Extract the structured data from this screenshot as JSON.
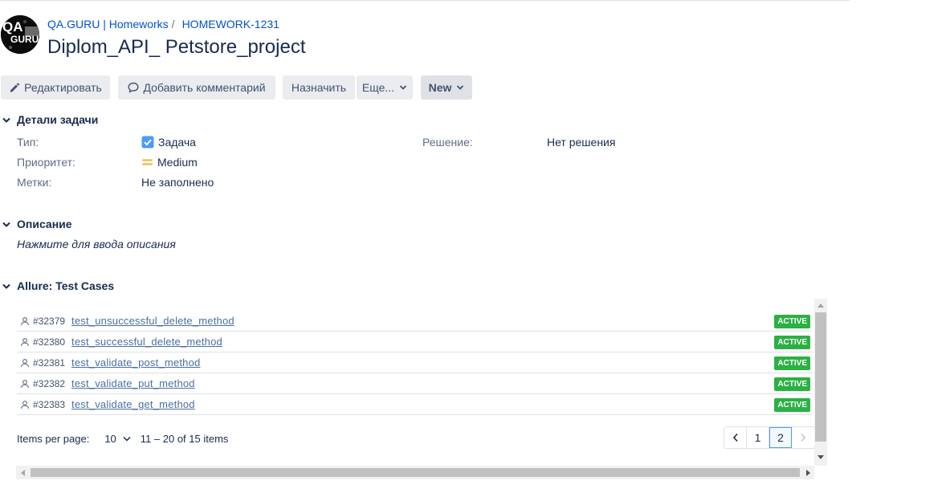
{
  "logo": {
    "text_top": "QA",
    "text_bottom": "GURU"
  },
  "breadcrumbs": [
    {
      "label": "QA.GURU | Homeworks"
    },
    {
      "label": "HOMEWORK-1231"
    }
  ],
  "breadcrumb_separator": "/",
  "issue": {
    "title": "Diplom_API_ Petstore_project"
  },
  "toolbar": {
    "edit_label": "Редактировать",
    "comment_label": "Добавить комментарий",
    "assign_label": "Назначить",
    "more_label": "Еще...",
    "status_label": "New"
  },
  "details": {
    "heading": "Детали задачи",
    "type_label": "Тип:",
    "type_value": "Задача",
    "priority_label": "Приоритет:",
    "priority_value": "Medium",
    "labels_label": "Метки:",
    "labels_value": "Не заполнено",
    "resolution_label": "Решение:",
    "resolution_value": "Нет решения"
  },
  "description": {
    "heading": "Описание",
    "placeholder": "Нажмите для ввода описания"
  },
  "allure": {
    "heading": "Allure: Test Cases",
    "test_cases": [
      {
        "id": "#32379",
        "name": "test_unsuccessful_delete_method",
        "status": "ACTIVE"
      },
      {
        "id": "#32380",
        "name": "test_successful_delete_method",
        "status": "ACTIVE"
      },
      {
        "id": "#32381",
        "name": "test_validate_post_method",
        "status": "ACTIVE"
      },
      {
        "id": "#32382",
        "name": "test_validate_put_method",
        "status": "ACTIVE"
      },
      {
        "id": "#32383",
        "name": "test_validate_get_method",
        "status": "ACTIVE"
      }
    ],
    "items_per_page_label": "Items per page:",
    "items_per_page_value": "10",
    "range_text": "11 – 20 of 15 items",
    "pages": [
      "1",
      "2"
    ],
    "current_page": "2"
  },
  "colors": {
    "link": "#0052cc",
    "active_badge": "#2bb044",
    "priority_medium": "#f0b323",
    "checkbox": "#4c9aff"
  }
}
